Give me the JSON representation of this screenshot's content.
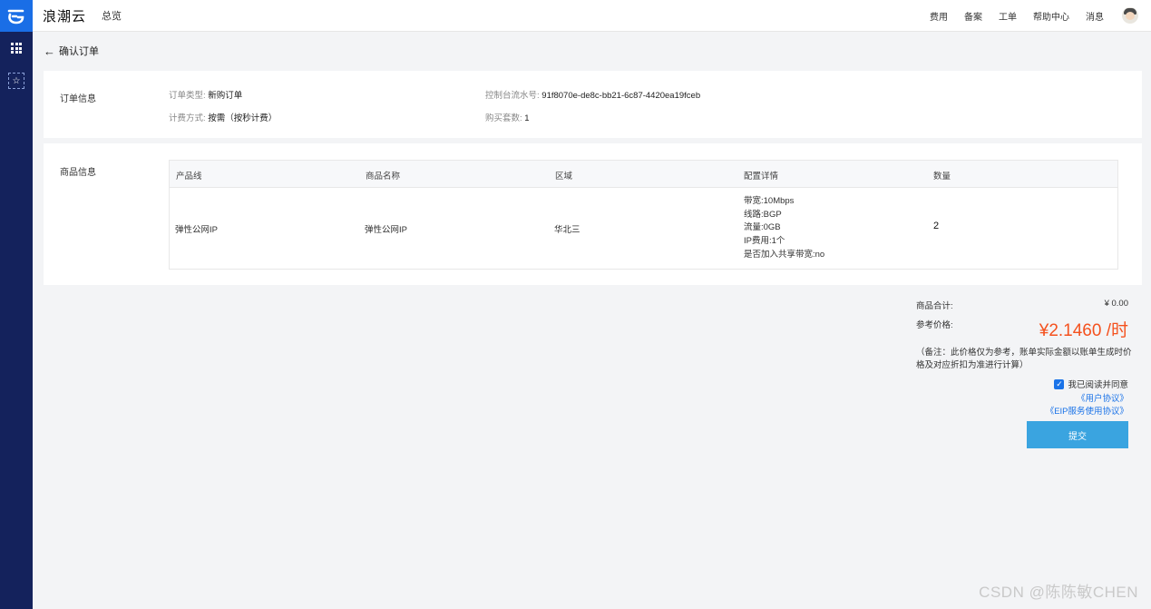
{
  "brand": {
    "name": "浪潮云",
    "nav_overview": "总览"
  },
  "topnav": {
    "items": [
      "费用",
      "备案",
      "工单",
      "帮助中心",
      "消息"
    ]
  },
  "colors": {
    "sidebar": "#14225c",
    "logo": "#1a6ee6",
    "price": "#f4511e",
    "submit": "#3aa4e0",
    "link": "#1a73e8"
  },
  "page": {
    "title": "确认订单"
  },
  "order_info": {
    "section_title": "订单信息",
    "order_type_label": "订单类型:",
    "order_type_value": "新购订单",
    "flow_no_label": "控制台流水号:",
    "flow_no_value": "91f8070e-de8c-bb21-6c87-4420ea19fceb",
    "billing_label": "计费方式:",
    "billing_value": "按需（按秒计费）",
    "sets_label": "购买套数:",
    "sets_value": "1"
  },
  "goods_info": {
    "section_title": "商品信息",
    "columns": [
      "产品线",
      "商品名称",
      "区域",
      "配置详情",
      "数量"
    ],
    "row": {
      "product_line": "弹性公网IP",
      "product_name": "弹性公网IP",
      "region": "华北三",
      "details": [
        "带宽:10Mbps",
        "线路:BGP",
        "流量:0GB",
        "IP费用:1个",
        "是否加入共享带宽:no"
      ],
      "quantity": "2"
    }
  },
  "summary": {
    "subtotal_label": "商品合计:",
    "subtotal_value": "¥ 0.00",
    "ref_price_label": "参考价格:",
    "ref_price_value": "¥2.1460 /时",
    "note": "（备注：此价格仅为参考，账单实际金额以账单生成时价格及对应折扣为准进行计算）",
    "agree_text": "我已阅读并同意",
    "user_agreement": "《用户协议》",
    "eip_agreement": "《EIP服务使用协议》",
    "submit_label": "提交"
  },
  "watermark": "CSDN @陈陈敏CHEN"
}
